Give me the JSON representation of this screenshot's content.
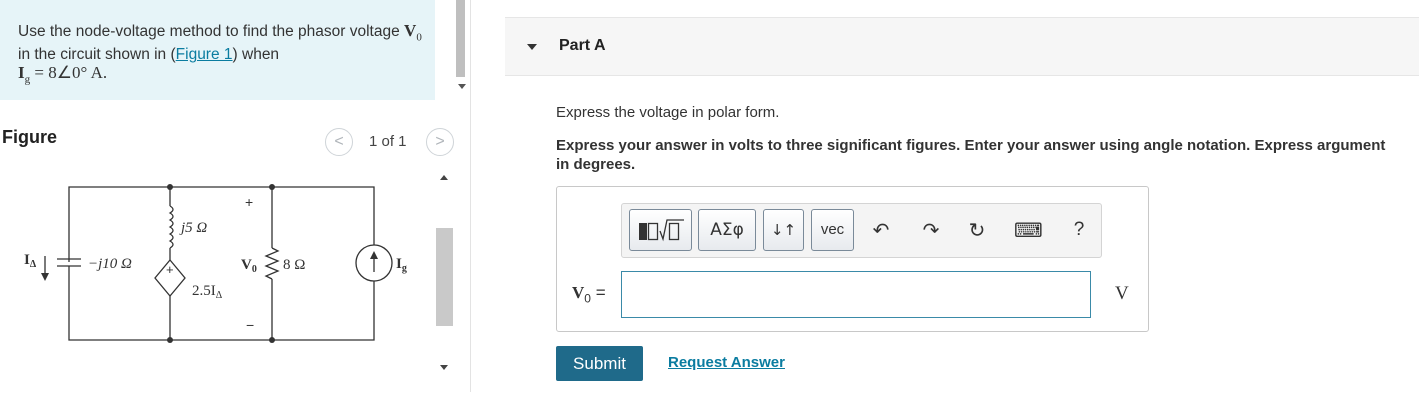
{
  "problem": {
    "text_before": "Use the node-voltage method to find the phasor voltage ",
    "text_vo": "V",
    "text_vo_sub": "0",
    "text_middle": " in the circuit shown in (",
    "figure_link": "Figure 1",
    "text_after": ") when",
    "ig_expression": "I",
    "ig_sub": "g",
    "ig_value": " = 8∠0° A."
  },
  "figure": {
    "title": "Figure",
    "counter": "1 of 1",
    "prev_icon": "chevron-left-icon",
    "next_icon": "chevron-right-icon",
    "labels": {
      "i_delta": "I",
      "i_delta_sub": "Δ",
      "cap": "−j10 Ω",
      "ind": "j5 Ω",
      "dep_source": "2.5I",
      "dep_source_sub": "Δ",
      "vo": "V",
      "vo_sub": "0",
      "res": "8 Ω",
      "ig": "I",
      "ig_sub": "g",
      "plus": "+",
      "minus": "−",
      "dep_plus": "+"
    }
  },
  "part": {
    "title": "Part A",
    "instruction": "Express the voltage in polar form.",
    "detail": "Express your answer in volts to three significant figures. Enter your answer using angle notation. Express argument in degrees."
  },
  "toolbar": {
    "greek_label": "ΑΣφ",
    "updown_label": "↓↑",
    "vec_label": "vec",
    "undo_icon": "↶",
    "redo_icon": "↷",
    "reset_icon": "↻",
    "keyboard_icon": "⌨",
    "help_label": "?"
  },
  "answer": {
    "label_v": "V",
    "label_sub": "0",
    "label_eq": " =",
    "value": "",
    "unit": "V"
  },
  "actions": {
    "submit": "Submit",
    "request": "Request Answer"
  }
}
